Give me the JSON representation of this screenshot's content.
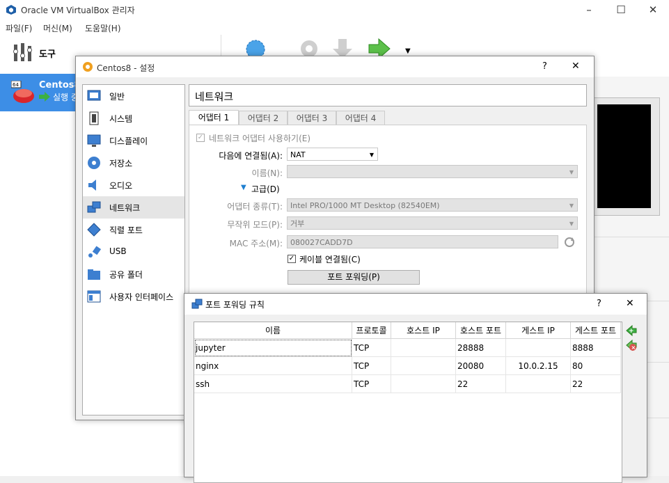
{
  "main_window": {
    "title": "Oracle VM VirtualBox 관리자",
    "menu": [
      "파일(F)",
      "머신(M)",
      "도움말(H)"
    ],
    "tools_label": "도구",
    "vm_name": "Centos8",
    "vm_state": "실행 중"
  },
  "settings": {
    "title": "Centos8 - 설정",
    "help": "?",
    "close": "✕",
    "sidebar": [
      {
        "label": "일반",
        "icon": "general-icon"
      },
      {
        "label": "시스템",
        "icon": "system-icon"
      },
      {
        "label": "디스플레이",
        "icon": "display-icon"
      },
      {
        "label": "저장소",
        "icon": "storage-icon"
      },
      {
        "label": "오디오",
        "icon": "audio-icon"
      },
      {
        "label": "네트워크",
        "icon": "network-icon"
      },
      {
        "label": "직렬 포트",
        "icon": "serial-port-icon"
      },
      {
        "label": "USB",
        "icon": "usb-icon"
      },
      {
        "label": "공유 폴더",
        "icon": "shared-folder-icon"
      },
      {
        "label": "사용자 인터페이스",
        "icon": "user-interface-icon"
      }
    ],
    "selected_section": "네트워크",
    "page_title": "네트워크",
    "tabs": [
      "어댑터 1",
      "어댑터 2",
      "어댑터 3",
      "어댑터 4"
    ],
    "active_tab": "어댑터 1",
    "enable_adapter_label": "네트워크 어댑터 사용하기(E)",
    "attached_to_label": "다음에 연결됨(A):",
    "attached_to_value": "NAT",
    "name_label": "이름(N):",
    "name_value": "",
    "advanced_label": "고급(D)",
    "adapter_type_label": "어댑터 종류(T):",
    "adapter_type_value": "Intel PRO/1000 MT Desktop (82540EM)",
    "promiscuous_label": "무작위 모드(P):",
    "promiscuous_value": "거부",
    "mac_label": "MAC 주소(M):",
    "mac_value": "080027CADD7D",
    "cable_connected_label": "케이블 연결됨(C)",
    "port_forwarding_button": "포트 포워딩(P)"
  },
  "port_forwarding": {
    "title": "포트 포워딩 규칙",
    "help": "?",
    "close": "✕",
    "columns": [
      "이름",
      "프로토콜",
      "호스트 IP",
      "호스트 포트",
      "게스트 IP",
      "게스트 포트"
    ],
    "rows": [
      {
        "name": "jupyter",
        "protocol": "TCP",
        "host_ip": "",
        "host_port": "28888",
        "guest_ip": "",
        "guest_port": "8888"
      },
      {
        "name": "nginx",
        "protocol": "TCP",
        "host_ip": "",
        "host_port": "20080",
        "guest_ip": "10.0.2.15",
        "guest_port": "80"
      },
      {
        "name": "ssh",
        "protocol": "TCP",
        "host_ip": "",
        "host_port": "22",
        "guest_ip": "",
        "guest_port": "22"
      }
    ]
  },
  "colors": {
    "selection_blue": "#3d8ee6",
    "add_icon": "#3cb043",
    "remove_icon": "#d9534f"
  }
}
